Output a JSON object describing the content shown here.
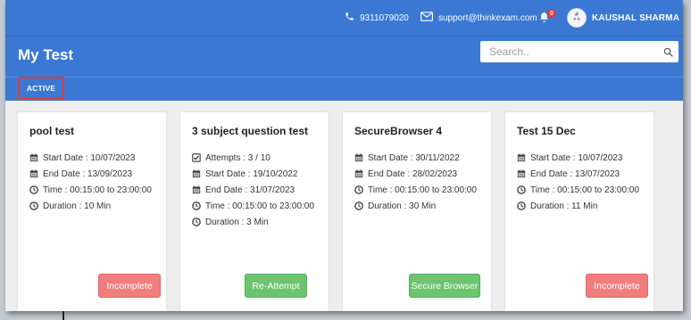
{
  "topbar": {
    "phone": "9311079020",
    "email": "support@thinkexam.com",
    "notification_count": "0",
    "user_name": "KAUSHAL SHARMA"
  },
  "header": {
    "title": "My Test",
    "search_placeholder": "Search.."
  },
  "tabs": [
    {
      "label": "ACTIVE"
    }
  ],
  "cards": [
    {
      "title": "pool test",
      "rows": [
        {
          "icon": "calendar-icon",
          "text": "Start Date : 10/07/2023"
        },
        {
          "icon": "calendar-icon",
          "text": "End Date : 13/09/2023"
        },
        {
          "icon": "clock-icon",
          "text": "Time : 00:15:00 to 23:00:00"
        },
        {
          "icon": "clock-icon",
          "text": "Duration : 10 Min"
        }
      ],
      "button": {
        "label": "Incomplete",
        "color": "#f07e7e"
      }
    },
    {
      "title": "3 subject question test",
      "rows": [
        {
          "icon": "checkbox-icon",
          "text": "Attempts : 3 / 10"
        },
        {
          "icon": "calendar-icon",
          "text": "Start Date : 19/10/2022"
        },
        {
          "icon": "calendar-icon",
          "text": "End Date : 31/07/2023"
        },
        {
          "icon": "clock-icon",
          "text": "Time : 00:15:00 to 23:00:00"
        },
        {
          "icon": "clock-icon",
          "text": "Duration : 3 Min"
        }
      ],
      "button": {
        "label": "Re-Attempt",
        "color": "#6cc46e"
      }
    },
    {
      "title": "SecureBrowser 4",
      "rows": [
        {
          "icon": "calendar-icon",
          "text": "Start Date : 30/11/2022"
        },
        {
          "icon": "calendar-icon",
          "text": "End Date : 28/02/2023"
        },
        {
          "icon": "clock-icon",
          "text": "Time : 00:15:00 to 23:00:00"
        },
        {
          "icon": "clock-icon",
          "text": "Duration : 30 Min"
        }
      ],
      "button": {
        "label": "Secure Browser",
        "color": "#6cc46e"
      }
    },
    {
      "title": "Test 15 Dec",
      "rows": [
        {
          "icon": "calendar-icon",
          "text": "Start Date : 10/07/2023"
        },
        {
          "icon": "calendar-icon",
          "text": "End Date : 13/07/2023"
        },
        {
          "icon": "clock-icon",
          "text": "Time : 00:15:00 to 23:00:00"
        },
        {
          "icon": "clock-icon",
          "text": "Duration : 11 Min"
        }
      ],
      "button": {
        "label": "Incomplete",
        "color": "#f07e7e"
      }
    }
  ],
  "colors": {
    "brand_blue": "#3a78d4",
    "tab_highlight": "#e53935",
    "incomplete": "#f07e7e",
    "success": "#6cc46e"
  }
}
